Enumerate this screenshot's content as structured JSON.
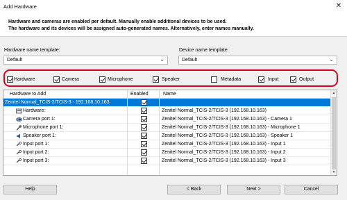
{
  "window": {
    "title": "Add Hardware"
  },
  "header": {
    "line1": "Hardware and cameras are enabled per default. Manually enable additional devices to be used.",
    "line2": "The hardware and its devices will be assigned auto-generated names. Alternatively, enter names manually."
  },
  "hardware_template": {
    "label": "Hardware name template:",
    "value": "Default"
  },
  "device_template": {
    "label": "Device name template:",
    "value": "Default"
  },
  "filters": [
    {
      "label": "Hardware",
      "checked": true
    },
    {
      "label": "Camera",
      "checked": true
    },
    {
      "label": "Microphone",
      "checked": true
    },
    {
      "label": "Speaker",
      "checked": true
    },
    {
      "label": "Metadata",
      "checked": false
    },
    {
      "label": "Input",
      "checked": true
    },
    {
      "label": "Output",
      "checked": true
    }
  ],
  "table": {
    "columns": [
      "Hardware to Add",
      "Enabled",
      "Name"
    ],
    "rows": [
      {
        "label": "Zenitel Normal_TCIS-2/TCIS-3 - 192.168.10.163",
        "name": "",
        "selected": true,
        "icon": ""
      },
      {
        "label": "Hardware:",
        "name": "Zenitel Normal_TCIS-2/TCIS-3 (192.168.10.163)",
        "selected": false,
        "icon": "hardware-icon"
      },
      {
        "label": "Camera port 1:",
        "name": "Zenitel Normal_TCIS-2/TCIS-3 (192.168.10.163) - Camera 1",
        "selected": false,
        "icon": "camera-icon"
      },
      {
        "label": "Microphone port 1:",
        "name": "Zenitel Normal_TCIS-2/TCIS-3 (192.168.10.163) - Microphone 1",
        "selected": false,
        "icon": "microphone-icon"
      },
      {
        "label": "Speaker port 1:",
        "name": "Zenitel Normal_TCIS-2/TCIS-3 (192.168.10.163) - Speaker 1",
        "selected": false,
        "icon": "speaker-icon"
      },
      {
        "label": "Input port 1:",
        "name": "Zenitel Normal_TCIS-2/TCIS-3 (192.168.10.163) - Input 1",
        "selected": false,
        "icon": "input-icon"
      },
      {
        "label": "Input port 2:",
        "name": "Zenitel Normal_TCIS-2/TCIS-3 (192.168.10.163) - Input 2",
        "selected": false,
        "icon": "input-icon"
      },
      {
        "label": "Input port 3:",
        "name": "Zenitel Normal_TCIS-2/TCIS-3 (192.168.10.163) - Input 3",
        "selected": false,
        "icon": "input-icon"
      }
    ]
  },
  "buttons": {
    "help": "Help",
    "back": "< Back",
    "next": "Next >",
    "cancel": "Cancel"
  },
  "colors": {
    "selection": "#0078d7",
    "highlight_border": "#d8001c"
  }
}
